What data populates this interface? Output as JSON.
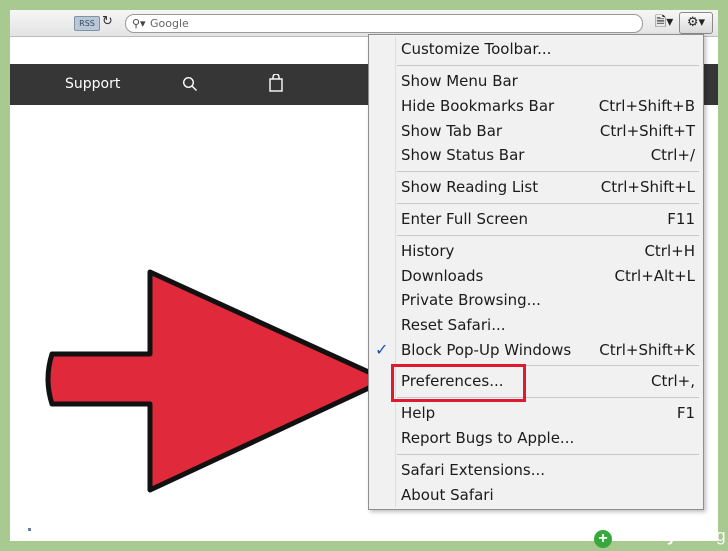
{
  "toolbar": {
    "rss_label": "RSS",
    "search_placeholder": "Google"
  },
  "page": {
    "support_label": "Support"
  },
  "menu": {
    "items": [
      {
        "label": "Customize Toolbar...",
        "shortcut": ""
      },
      {
        "label": "Show Menu Bar",
        "shortcut": ""
      },
      {
        "label": "Hide Bookmarks Bar",
        "shortcut": "Ctrl+Shift+B"
      },
      {
        "label": "Show Tab Bar",
        "shortcut": "Ctrl+Shift+T"
      },
      {
        "label": "Show Status Bar",
        "shortcut": "Ctrl+/"
      },
      {
        "label": "Show Reading List",
        "shortcut": "Ctrl+Shift+L"
      },
      {
        "label": "Enter Full Screen",
        "shortcut": "F11"
      },
      {
        "label": "History",
        "shortcut": "Ctrl+H"
      },
      {
        "label": "Downloads",
        "shortcut": "Ctrl+Alt+L"
      },
      {
        "label": "Private Browsing...",
        "shortcut": ""
      },
      {
        "label": "Reset Safari...",
        "shortcut": ""
      },
      {
        "label": "Block Pop-Up Windows",
        "shortcut": "Ctrl+Shift+K",
        "checked": true
      },
      {
        "label": "Preferences...",
        "shortcut": "Ctrl+,"
      },
      {
        "label": "Help",
        "shortcut": "F1"
      },
      {
        "label": "Report Bugs to Apple...",
        "shortcut": ""
      },
      {
        "label": "Safari Extensions...",
        "shortcut": ""
      },
      {
        "label": "About Safari",
        "shortcut": ""
      }
    ]
  },
  "watermark": {
    "brand": "Healthy",
    "brand2": "Living"
  },
  "colors": {
    "arrow": "#e0293b",
    "highlight": "#e0192e",
    "check": "#1f4fb3"
  }
}
